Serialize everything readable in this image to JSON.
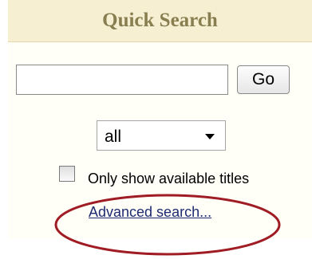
{
  "header": {
    "title": "Quick Search"
  },
  "search": {
    "value": "",
    "placeholder": "",
    "go_label": "Go"
  },
  "scope": {
    "selected": "all"
  },
  "filter": {
    "label": "Only show available titles",
    "checked": false
  },
  "advanced": {
    "label": "Advanced search..."
  },
  "colors": {
    "header_bg": "#f6efd2",
    "header_text": "#887e50",
    "link": "#1e2a72",
    "annotation": "#a01c24"
  }
}
